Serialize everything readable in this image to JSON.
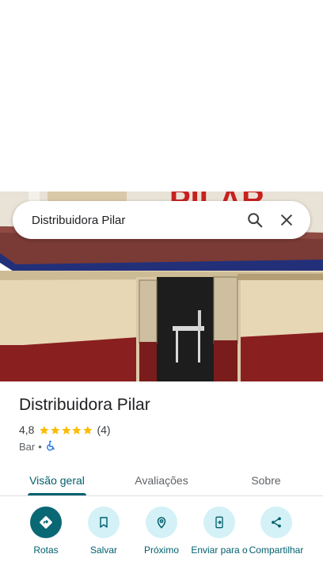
{
  "search": {
    "query": "Distribuidora Pilar",
    "search_icon": "search-icon",
    "close_icon": "close-icon"
  },
  "photo": {
    "sign_text": "PILAR"
  },
  "place": {
    "name": "Distribuidora Pilar",
    "rating": "4,8",
    "rating_value": 4.8,
    "review_count": "(4)",
    "category": "Bar",
    "separator": "•",
    "accessibility_icon": "wheelchair-icon"
  },
  "tabs": [
    {
      "label": "Visão geral",
      "active": true
    },
    {
      "label": "Avaliações",
      "active": false
    },
    {
      "label": "Sobre",
      "active": false
    }
  ],
  "actions": [
    {
      "label": "Rotas",
      "icon": "directions-icon"
    },
    {
      "label": "Salvar",
      "icon": "bookmark-icon"
    },
    {
      "label": "Próximo",
      "icon": "nearby-icon"
    },
    {
      "label": "Enviar para o",
      "icon": "send-to-phone-icon"
    },
    {
      "label": "Compartilhar",
      "icon": "share-icon"
    }
  ],
  "colors": {
    "accent": "#00606e",
    "primary_button": "#0a6874",
    "tonal_button": "#d3f1f6",
    "star": "#fbbc04"
  }
}
